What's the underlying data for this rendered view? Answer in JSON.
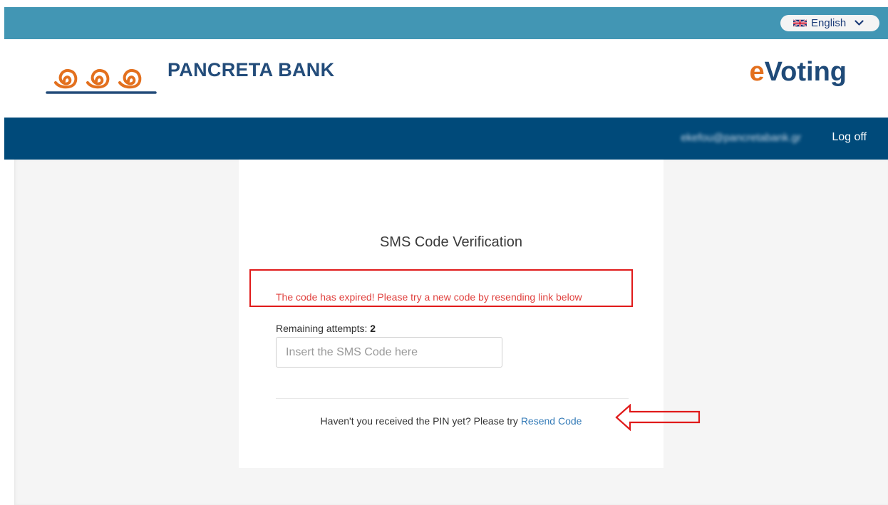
{
  "top_bar": {
    "language": {
      "selected": "English",
      "flag_icon": "uk-flag-icon",
      "chevron_icon": "chevron-down-icon"
    }
  },
  "brand": {
    "logo_icon": "pancreta-wave-logo-icon",
    "bank_name": "PANCRETA BANK",
    "product_prefix": "e",
    "product_rest": "Voting",
    "colors": {
      "accent_orange": "#e3701e",
      "brand_blue": "#1f4a78"
    }
  },
  "nav": {
    "user_email": "ekefou@pancretabank.gr",
    "logoff_label": "Log off"
  },
  "verification": {
    "title": "SMS Code Verification",
    "error_message": "The code has expired! Please try a new code by resending link below",
    "attempts_label": "Remaining attempts:",
    "attempts_count": "2",
    "input": {
      "placeholder": "Insert the SMS Code here",
      "value": ""
    },
    "pin_text": "Haven't you received the PIN yet? Please try",
    "resend_label": "Resend Code"
  },
  "annotations": {
    "error_box_color": "#e01a1a",
    "arrow_icon": "left-arrow-outline-icon"
  }
}
